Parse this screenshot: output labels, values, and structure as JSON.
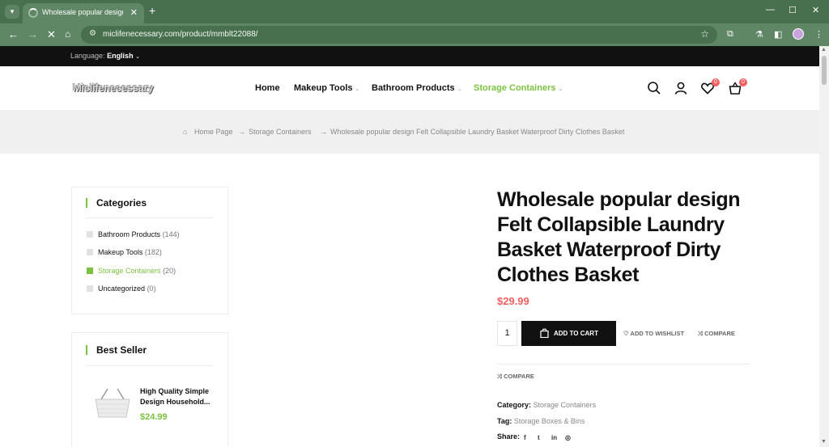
{
  "browser": {
    "tab_title": "Wholesale popular design Felt",
    "tab_close": "✕",
    "new_tab": "+",
    "url": "miclifenecessary.com/product/mmblt22088/"
  },
  "topbar": {
    "language_label": "Language:",
    "language_value": "English"
  },
  "header": {
    "logo": "Miclifenecessary",
    "menu": [
      {
        "label": "Home"
      },
      {
        "label": "Makeup Tools"
      },
      {
        "label": "Bathroom Products"
      },
      {
        "label": "Storage Containers"
      }
    ],
    "wishlist_count": "0",
    "cart_count": "0"
  },
  "breadcrumb": {
    "home": "Home Page",
    "category": "Storage Containers",
    "current": "Wholesale popular design Felt Collapsible Laundry Basket Waterproof Dirty Clothes Basket",
    "separator": "→"
  },
  "sidebar": {
    "categories_title": "Categories",
    "categories": [
      {
        "name": "Bathroom Products",
        "count": "(144)"
      },
      {
        "name": "Makeup Tools",
        "count": "(182)"
      },
      {
        "name": "Storage Containers",
        "count": "(20)"
      },
      {
        "name": "Uncategorized",
        "count": "(0)"
      }
    ],
    "bestseller_title": "Best Seller",
    "bestseller": {
      "name": "High Quality Simple Design Household...",
      "price": "$24.99"
    }
  },
  "product": {
    "title": "Wholesale popular design Felt Collapsible Laundry Basket Waterproof Dirty Clothes Basket",
    "price": "$29.99",
    "quantity": "1",
    "add_to_cart": "ADD TO CART",
    "add_to_wishlist": "ADD TO WISHLIST",
    "compare": "COMPARE",
    "compare2": "COMPARE",
    "category_label": "Category:",
    "category_value": "Storage Containers",
    "tag_label": "Tag:",
    "tag_value": "Storage Boxes & Bins",
    "share_label": "Share:"
  },
  "colors": {
    "accent": "#7cc242",
    "sale": "#f06060",
    "chrome": "#48704f"
  }
}
